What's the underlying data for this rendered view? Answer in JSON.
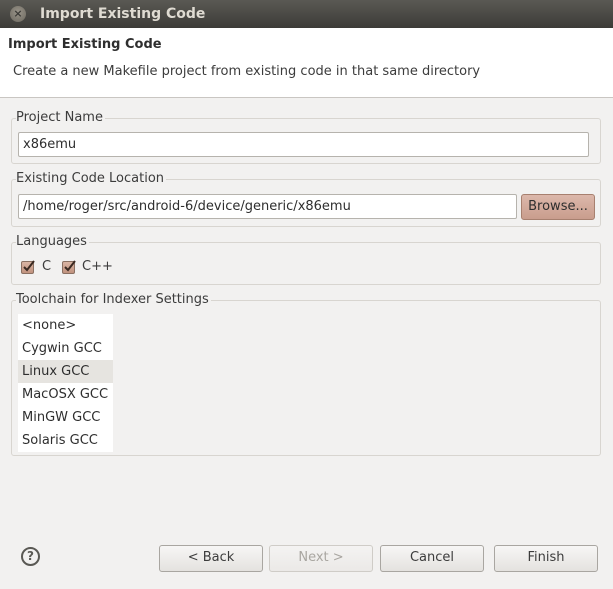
{
  "window": {
    "title": "Import Existing Code",
    "close_glyph": "×"
  },
  "header": {
    "title": "Import Existing Code",
    "description": "Create a new Makefile project from existing code in that same directory"
  },
  "project_name": {
    "label": "Project Name",
    "value": "x86emu"
  },
  "code_location": {
    "label": "Existing Code Location",
    "value": "/home/roger/src/android-6/device/generic/x86emu",
    "browse_label": "Browse..."
  },
  "languages": {
    "label": "Languages",
    "items": [
      {
        "label": "C",
        "checked": true
      },
      {
        "label": "C++",
        "checked": true
      }
    ]
  },
  "toolchain": {
    "label": "Toolchain for Indexer Settings",
    "items": [
      "<none>",
      "Cygwin GCC",
      "Linux GCC",
      "MacOSX GCC",
      "MinGW GCC",
      "Solaris GCC"
    ],
    "selected": "Linux GCC"
  },
  "buttons": {
    "help_glyph": "?",
    "back": "< Back",
    "next": "Next >",
    "cancel": "Cancel",
    "finish": "Finish"
  },
  "colors": {
    "titlebar": "#3c3b37",
    "browse_accent": "#c99d8d",
    "checkbox_accent": "#c1927e",
    "selection": "#e6e4e0"
  }
}
